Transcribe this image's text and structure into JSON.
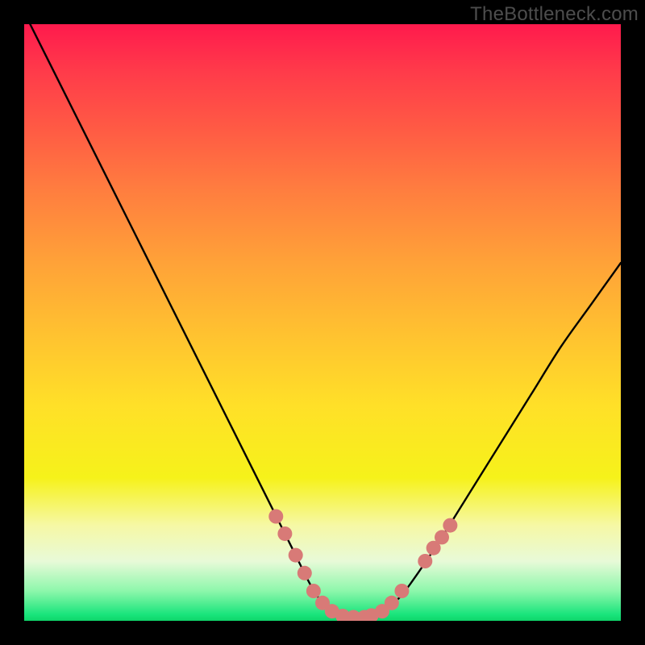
{
  "brand": "TheBottleneck.com",
  "chart_data": {
    "type": "line",
    "title": "",
    "xlabel": "",
    "ylabel": "",
    "xlim": [
      0,
      100
    ],
    "ylim": [
      0,
      100
    ],
    "grid": false,
    "series": [
      {
        "name": "curve",
        "x": [
          0,
          5,
          10,
          15,
          20,
          25,
          30,
          35,
          40,
          45,
          48,
          50,
          52,
          54,
          56,
          58,
          60,
          63,
          66,
          70,
          75,
          80,
          85,
          90,
          95,
          100
        ],
        "values": [
          102,
          92,
          82,
          72,
          62,
          52,
          42,
          32,
          22,
          12,
          6,
          3,
          1.5,
          0.8,
          0.5,
          0.8,
          1.5,
          4,
          8,
          14,
          22,
          30,
          38,
          46,
          53,
          60
        ]
      }
    ],
    "markers": {
      "name": "dots",
      "color": "#d87a77",
      "radius_px": 9,
      "points": [
        {
          "x": 42.2,
          "y": 17.5
        },
        {
          "x": 43.7,
          "y": 14.6
        },
        {
          "x": 45.5,
          "y": 11.0
        },
        {
          "x": 47.0,
          "y": 8.0
        },
        {
          "x": 48.5,
          "y": 5.0
        },
        {
          "x": 50.0,
          "y": 3.0
        },
        {
          "x": 51.6,
          "y": 1.6
        },
        {
          "x": 53.4,
          "y": 0.8
        },
        {
          "x": 55.2,
          "y": 0.6
        },
        {
          "x": 57.0,
          "y": 0.6
        },
        {
          "x": 58.2,
          "y": 0.9
        },
        {
          "x": 60.0,
          "y": 1.6
        },
        {
          "x": 61.6,
          "y": 3.0
        },
        {
          "x": 63.3,
          "y": 5.0
        },
        {
          "x": 67.2,
          "y": 10.0
        },
        {
          "x": 68.6,
          "y": 12.2
        },
        {
          "x": 70.0,
          "y": 14.0
        },
        {
          "x": 71.4,
          "y": 16.0
        }
      ]
    }
  }
}
